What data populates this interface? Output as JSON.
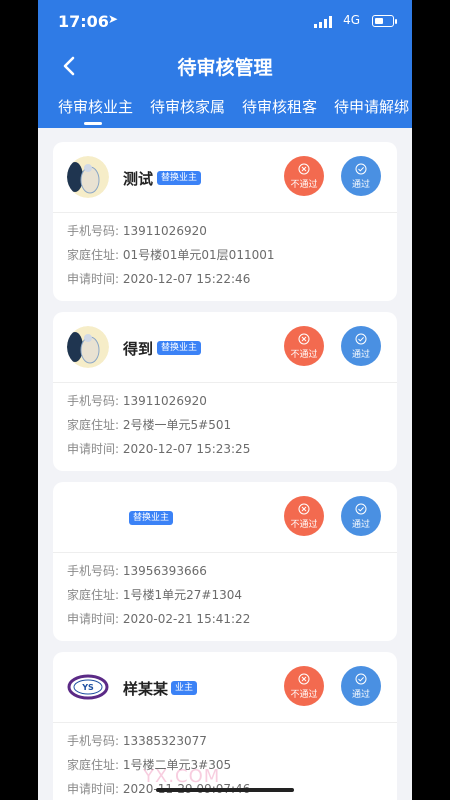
{
  "status": {
    "time": "17:06",
    "network": "4G"
  },
  "header": {
    "title": "待审核管理"
  },
  "tabs": [
    {
      "label": "待审核业主",
      "active": true
    },
    {
      "label": "待审核家属",
      "active": false
    },
    {
      "label": "待审核租客",
      "active": false
    },
    {
      "label": "待申请解绑",
      "active": false
    }
  ],
  "labels": {
    "phone": "手机号码:",
    "address": "家庭住址:",
    "apply_time": "申请时间:"
  },
  "actions": {
    "reject": "不通过",
    "pass": "通过"
  },
  "cards": [
    {
      "name": "测试",
      "badge": "替换业主",
      "phone": "13911026920",
      "address": "01号楼01单元01层011001",
      "time": "2020-12-07 15:22:46"
    },
    {
      "name": "得到",
      "badge": "替换业主",
      "phone": "13911026920",
      "address": "2号楼一单元5#501",
      "time": "2020-12-07 15:23:25"
    },
    {
      "name": "",
      "badge": "替换业主",
      "phone": "13956393666",
      "address": "1号楼1单元27#1304",
      "time": "2020-02-21 15:41:22"
    },
    {
      "name": "样某某",
      "badge": "业主",
      "phone": "13385323077",
      "address": "1号楼二单元3#305",
      "time": "2020-11-29 09:07:46"
    }
  ],
  "watermark": "YX.COM",
  "colors": {
    "header": "#2f7be6",
    "reject": "#f36a4f",
    "pass": "#4a90e2",
    "badge": "#3b82f6"
  }
}
